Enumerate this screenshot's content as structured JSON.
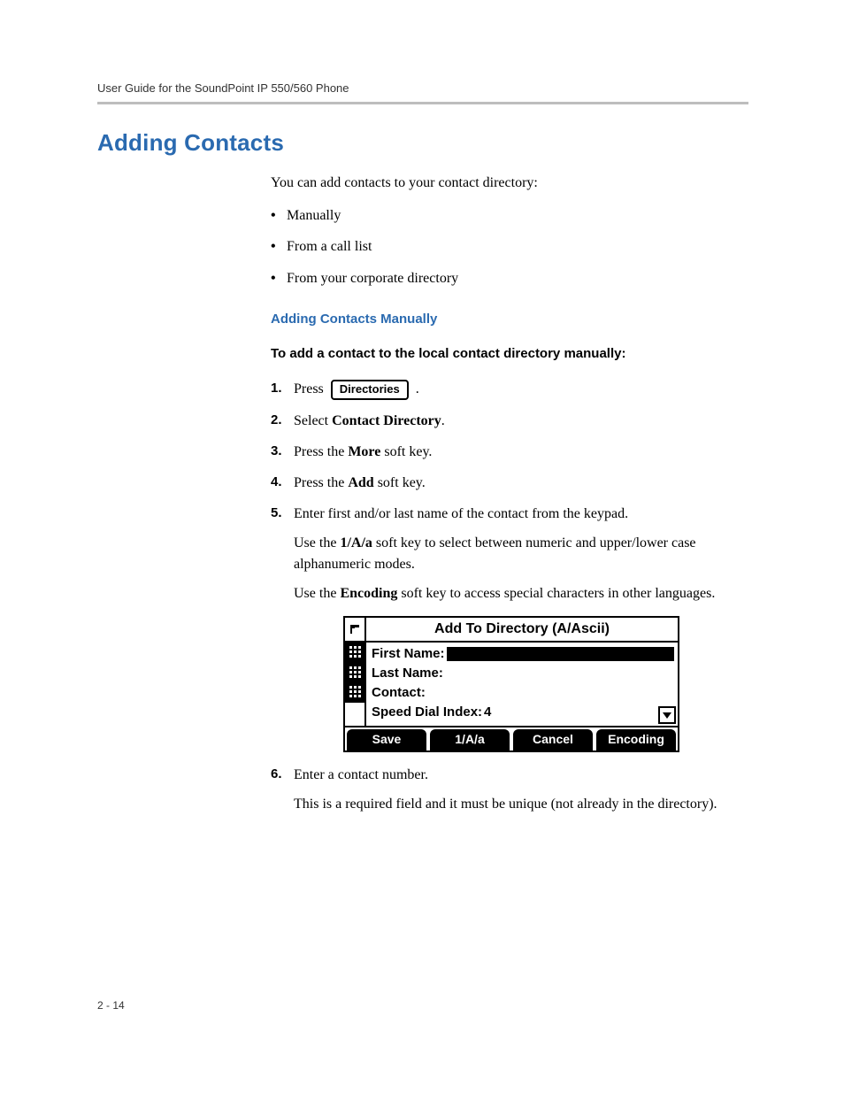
{
  "header": {
    "running": "User Guide for the SoundPoint IP 550/560 Phone"
  },
  "section": {
    "title": "Adding Contacts"
  },
  "intro": "You can add contacts to your contact directory:",
  "bullets": [
    "Manually",
    "From a call list",
    "From your corporate directory"
  ],
  "subsection": {
    "title": "Adding Contacts Manually"
  },
  "instruction": "To add a contact to the local contact directory manually:",
  "steps": {
    "s1": {
      "pre": "Press",
      "button": "Directories",
      "post": "."
    },
    "s2": {
      "pre": "Select ",
      "bold": "Contact Directory",
      "post": "."
    },
    "s3": {
      "pre": "Press the ",
      "bold": "More",
      "post": " soft key."
    },
    "s4": {
      "pre": "Press the ",
      "bold": "Add",
      "post": " soft key."
    },
    "s5": {
      "line": "Enter first and/or last name of the contact from the keypad.",
      "para1_pre": "Use the ",
      "para1_bold": "1/A/a",
      "para1_post": " soft key to select between numeric and upper/lower case alphanumeric modes.",
      "para2_pre": "Use the ",
      "para2_bold": "Encoding",
      "para2_post": " soft key to access special characters in other languages."
    },
    "s6": {
      "line": "Enter a contact number.",
      "para": "This is a required field and it must be unique (not already in the directory)."
    }
  },
  "phone": {
    "title": "Add To Directory (A/Ascii)",
    "fields": {
      "f1": "First Name:",
      "f2": "Last Name:",
      "f3": "Contact:",
      "f4_label": "Speed Dial Index:",
      "f4_value": "4"
    },
    "softkeys": [
      "Save",
      "1/A/a",
      "Cancel",
      "Encoding"
    ]
  },
  "footer": {
    "pagenum": "2 - 14"
  }
}
